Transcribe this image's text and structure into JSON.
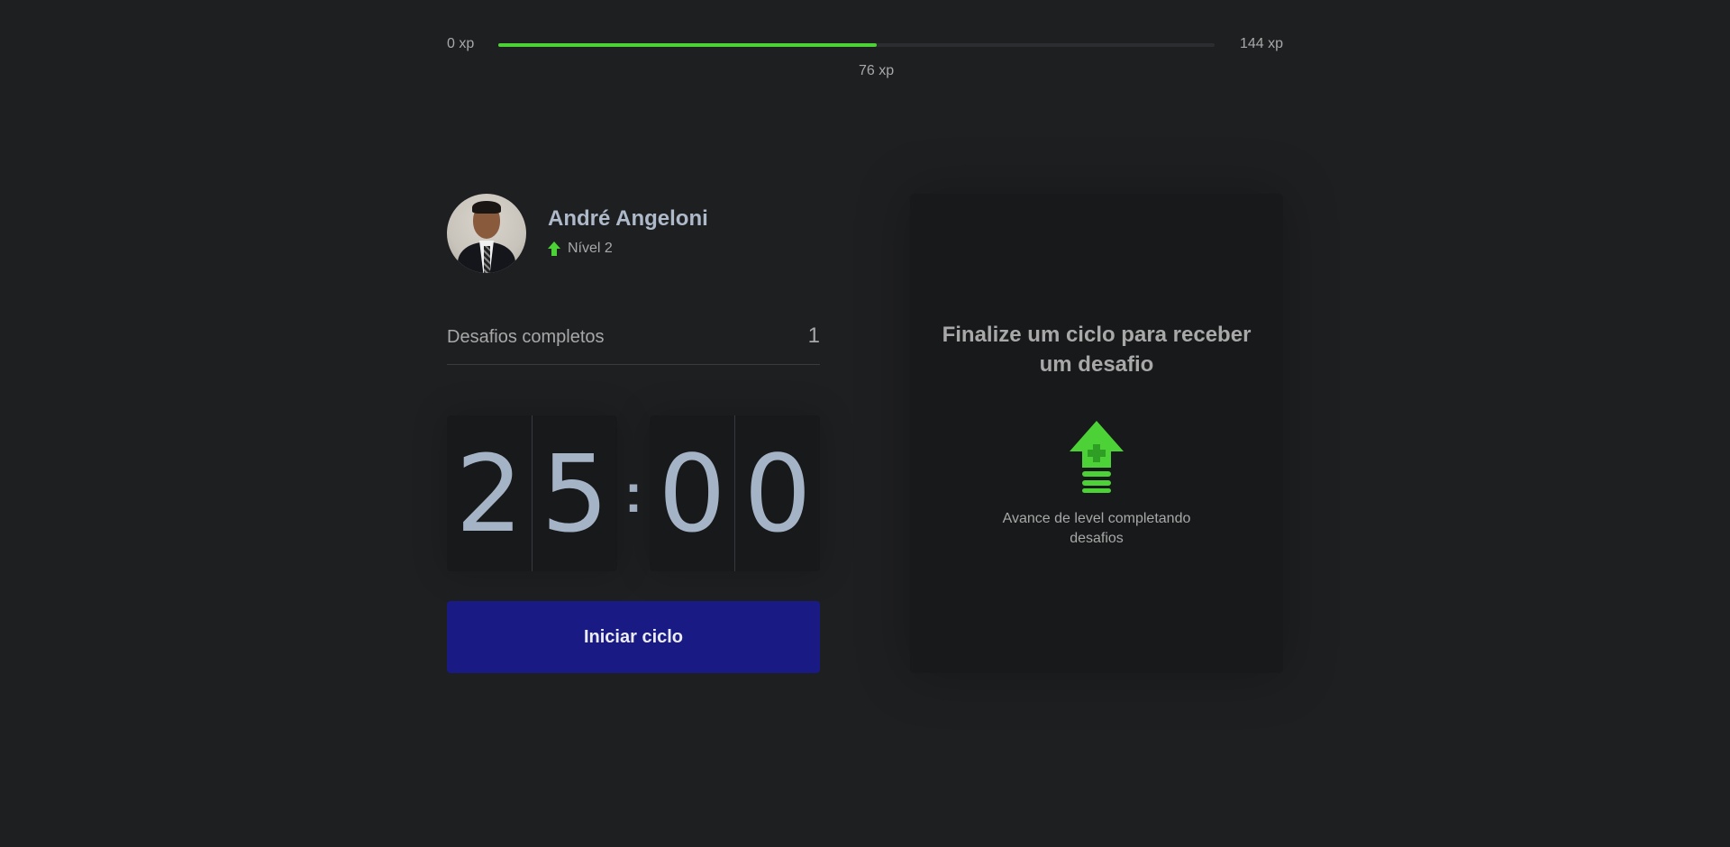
{
  "xp": {
    "min_label": "0 xp",
    "max_label": "144 xp",
    "current_label": "76 xp",
    "current": 76,
    "max": 144
  },
  "profile": {
    "name": "André Angeloni",
    "level_label": "Nível 2",
    "level_icon": "level-up-arrow-icon"
  },
  "challenges": {
    "label": "Desafios completos",
    "count": "1"
  },
  "timer": {
    "minute_tens": "2",
    "minute_ones": "5",
    "separator": ":",
    "second_tens": "0",
    "second_ones": "0"
  },
  "start_button": {
    "label": "Iniciar ciclo"
  },
  "challenge_card": {
    "title": "Finalize um ciclo para receber um desafio",
    "icon": "level-up-icon",
    "text": "Avance de level completando desafios"
  },
  "colors": {
    "background": "#1e1f21",
    "accent": "#4cd137",
    "button": "#1a1a84",
    "card": "#18191a"
  }
}
